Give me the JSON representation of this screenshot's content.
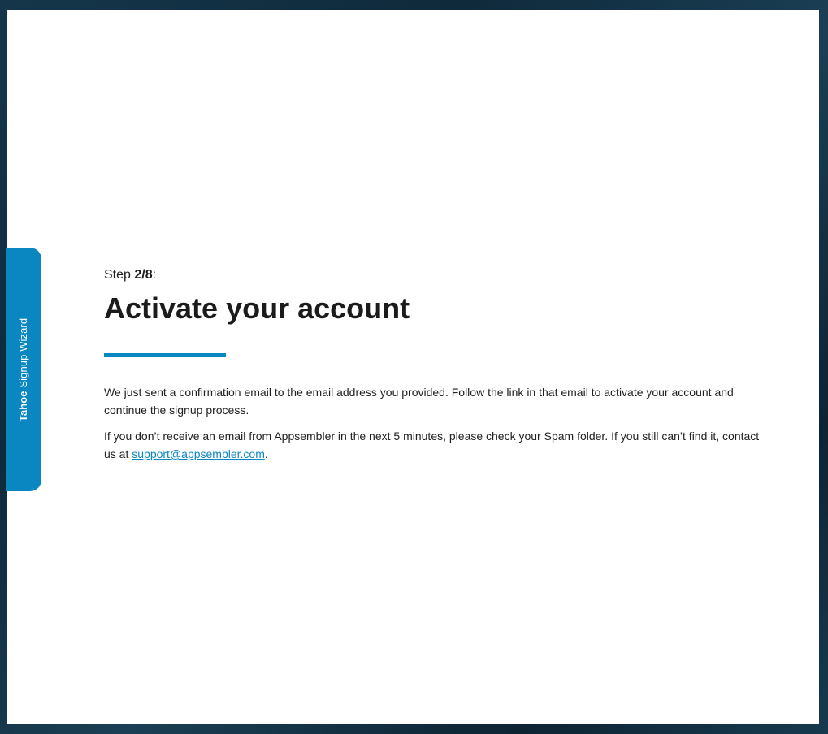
{
  "wizard_tab": {
    "brand": "Tahoe",
    "label": "Signup Wizard"
  },
  "step": {
    "prefix": "Step",
    "current": "2/8",
    "suffix": ":"
  },
  "title": "Activate your account",
  "paragraphs": {
    "confirmation": "We just sent a confirmation email to the email address you provided. Follow the link in that email to activate your account and continue the signup process.",
    "spam_text": "If you don’t receive an email from Appsembler in the next 5 minutes, please check your Spam folder. If you still can’t find it, contact us at",
    "support_email": "support@appsembler.com",
    "end_punct": "."
  },
  "colors": {
    "accent": "#0a86c1",
    "text": "#1f1f1f",
    "panel": "#ffffff"
  }
}
